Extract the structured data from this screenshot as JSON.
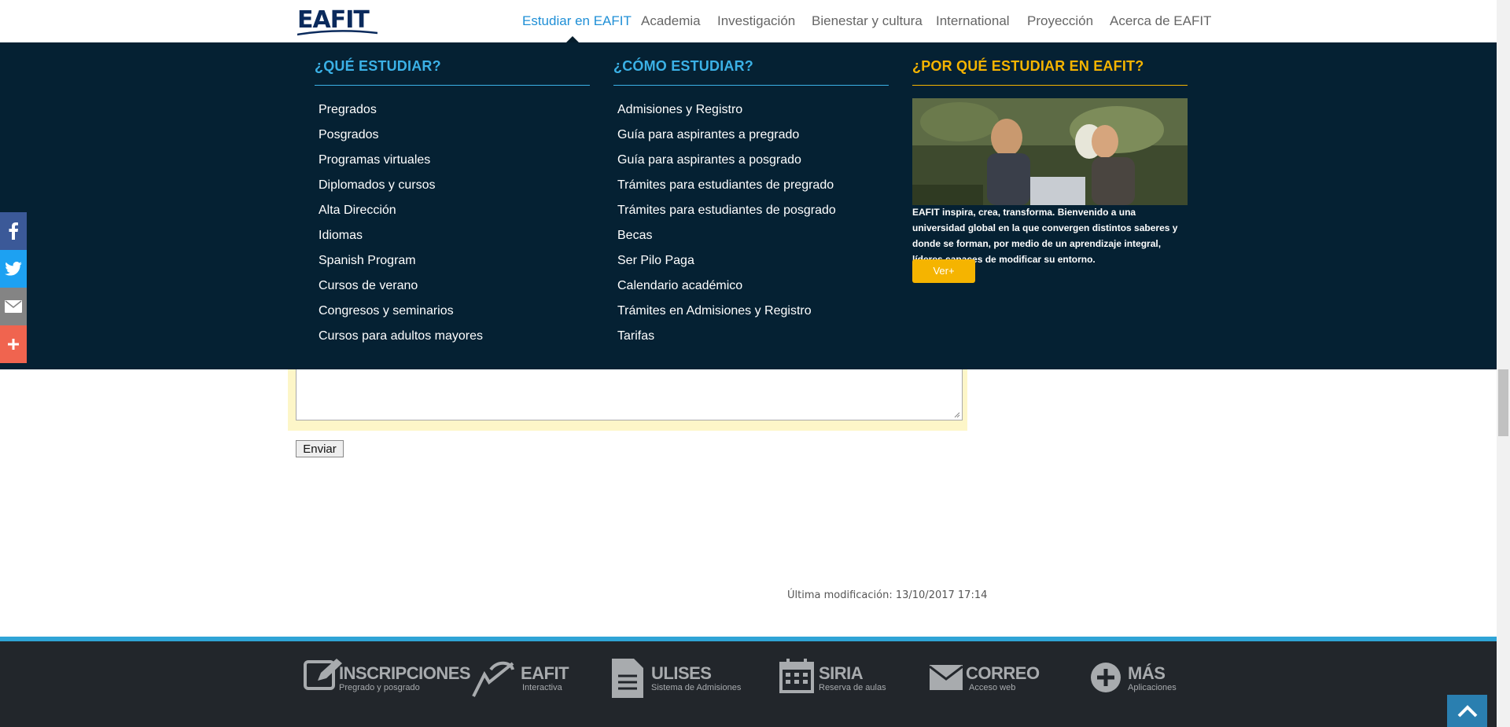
{
  "brand": {
    "logo_text": "EAFIT"
  },
  "nav": {
    "items": [
      "Estudiar en EAFIT",
      "Academia",
      "Investigación",
      "Bienestar y cultura",
      "International",
      "Proyección",
      "Acerca de EAFIT"
    ],
    "active": "Estudiar en EAFIT"
  },
  "mega_menu": {
    "col1": {
      "title": "¿QUÉ ESTUDIAR?",
      "items": [
        "Pregrados",
        "Posgrados",
        "Programas virtuales",
        "Diplomados y cursos",
        "Alta Dirección",
        "Idiomas",
        "Spanish Program",
        "Cursos de verano",
        "Congresos y seminarios",
        "Cursos para adultos mayores"
      ]
    },
    "col2": {
      "title": "¿CÓMO ESTUDIAR?",
      "items": [
        "Admisiones y Registro",
        "Guía para aspirantes a pregrado",
        "Guía para aspirantes a posgrado",
        "Trámites para estudiantes de pregrado",
        "Trámites para estudiantes de posgrado",
        "Becas",
        "Ser Pilo Paga",
        "Calendario académico",
        "Trámites en Admisiones y Registro",
        "Tarifas"
      ]
    },
    "col3": {
      "title": "¿POR QUÉ ESTUDIAR EN EAFIT?",
      "text": "EAFIT inspira, crea, transforma. Bienvenido a una universidad global en la que convergen distintos saberes y donde se forman, por medio de un aprendizaje integral, líderes capaces de modificar su entorno.",
      "button": "Ver+"
    }
  },
  "social": [
    {
      "icon": "facebook-icon",
      "color": "#3b5998"
    },
    {
      "icon": "twitter-icon",
      "color": "#1da1f2"
    },
    {
      "icon": "email-icon",
      "color": "#848484"
    },
    {
      "icon": "plus-icon",
      "color": "#f0644f"
    }
  ],
  "form": {
    "submit_label": "Enviar"
  },
  "last_modified": "Última modificación: 13/10/2017 17:14",
  "footer_apps": [
    {
      "icon": "edit-icon",
      "name": "INSCRIPCIONES",
      "sub": "Pregrado y posgrado"
    },
    {
      "icon": "cursor-icon",
      "name": "EAFIT",
      "sub": "Interactiva"
    },
    {
      "icon": "document-icon",
      "name": "ULISES",
      "sub": "Sistema de Admisiones"
    },
    {
      "icon": "calendar-icon",
      "name": "SIRIA",
      "sub": "Reserva de aulas"
    },
    {
      "icon": "mail-icon",
      "name": "CORREO",
      "sub": "Acceso web"
    },
    {
      "icon": "plus-circle-icon",
      "name": "MÁS",
      "sub": "Aplicaciones"
    }
  ],
  "colors": {
    "menu_bg": "#052133",
    "accent_blue": "#3bb1e6",
    "accent_yellow": "#f5b400",
    "footer_bg": "#22262b"
  }
}
